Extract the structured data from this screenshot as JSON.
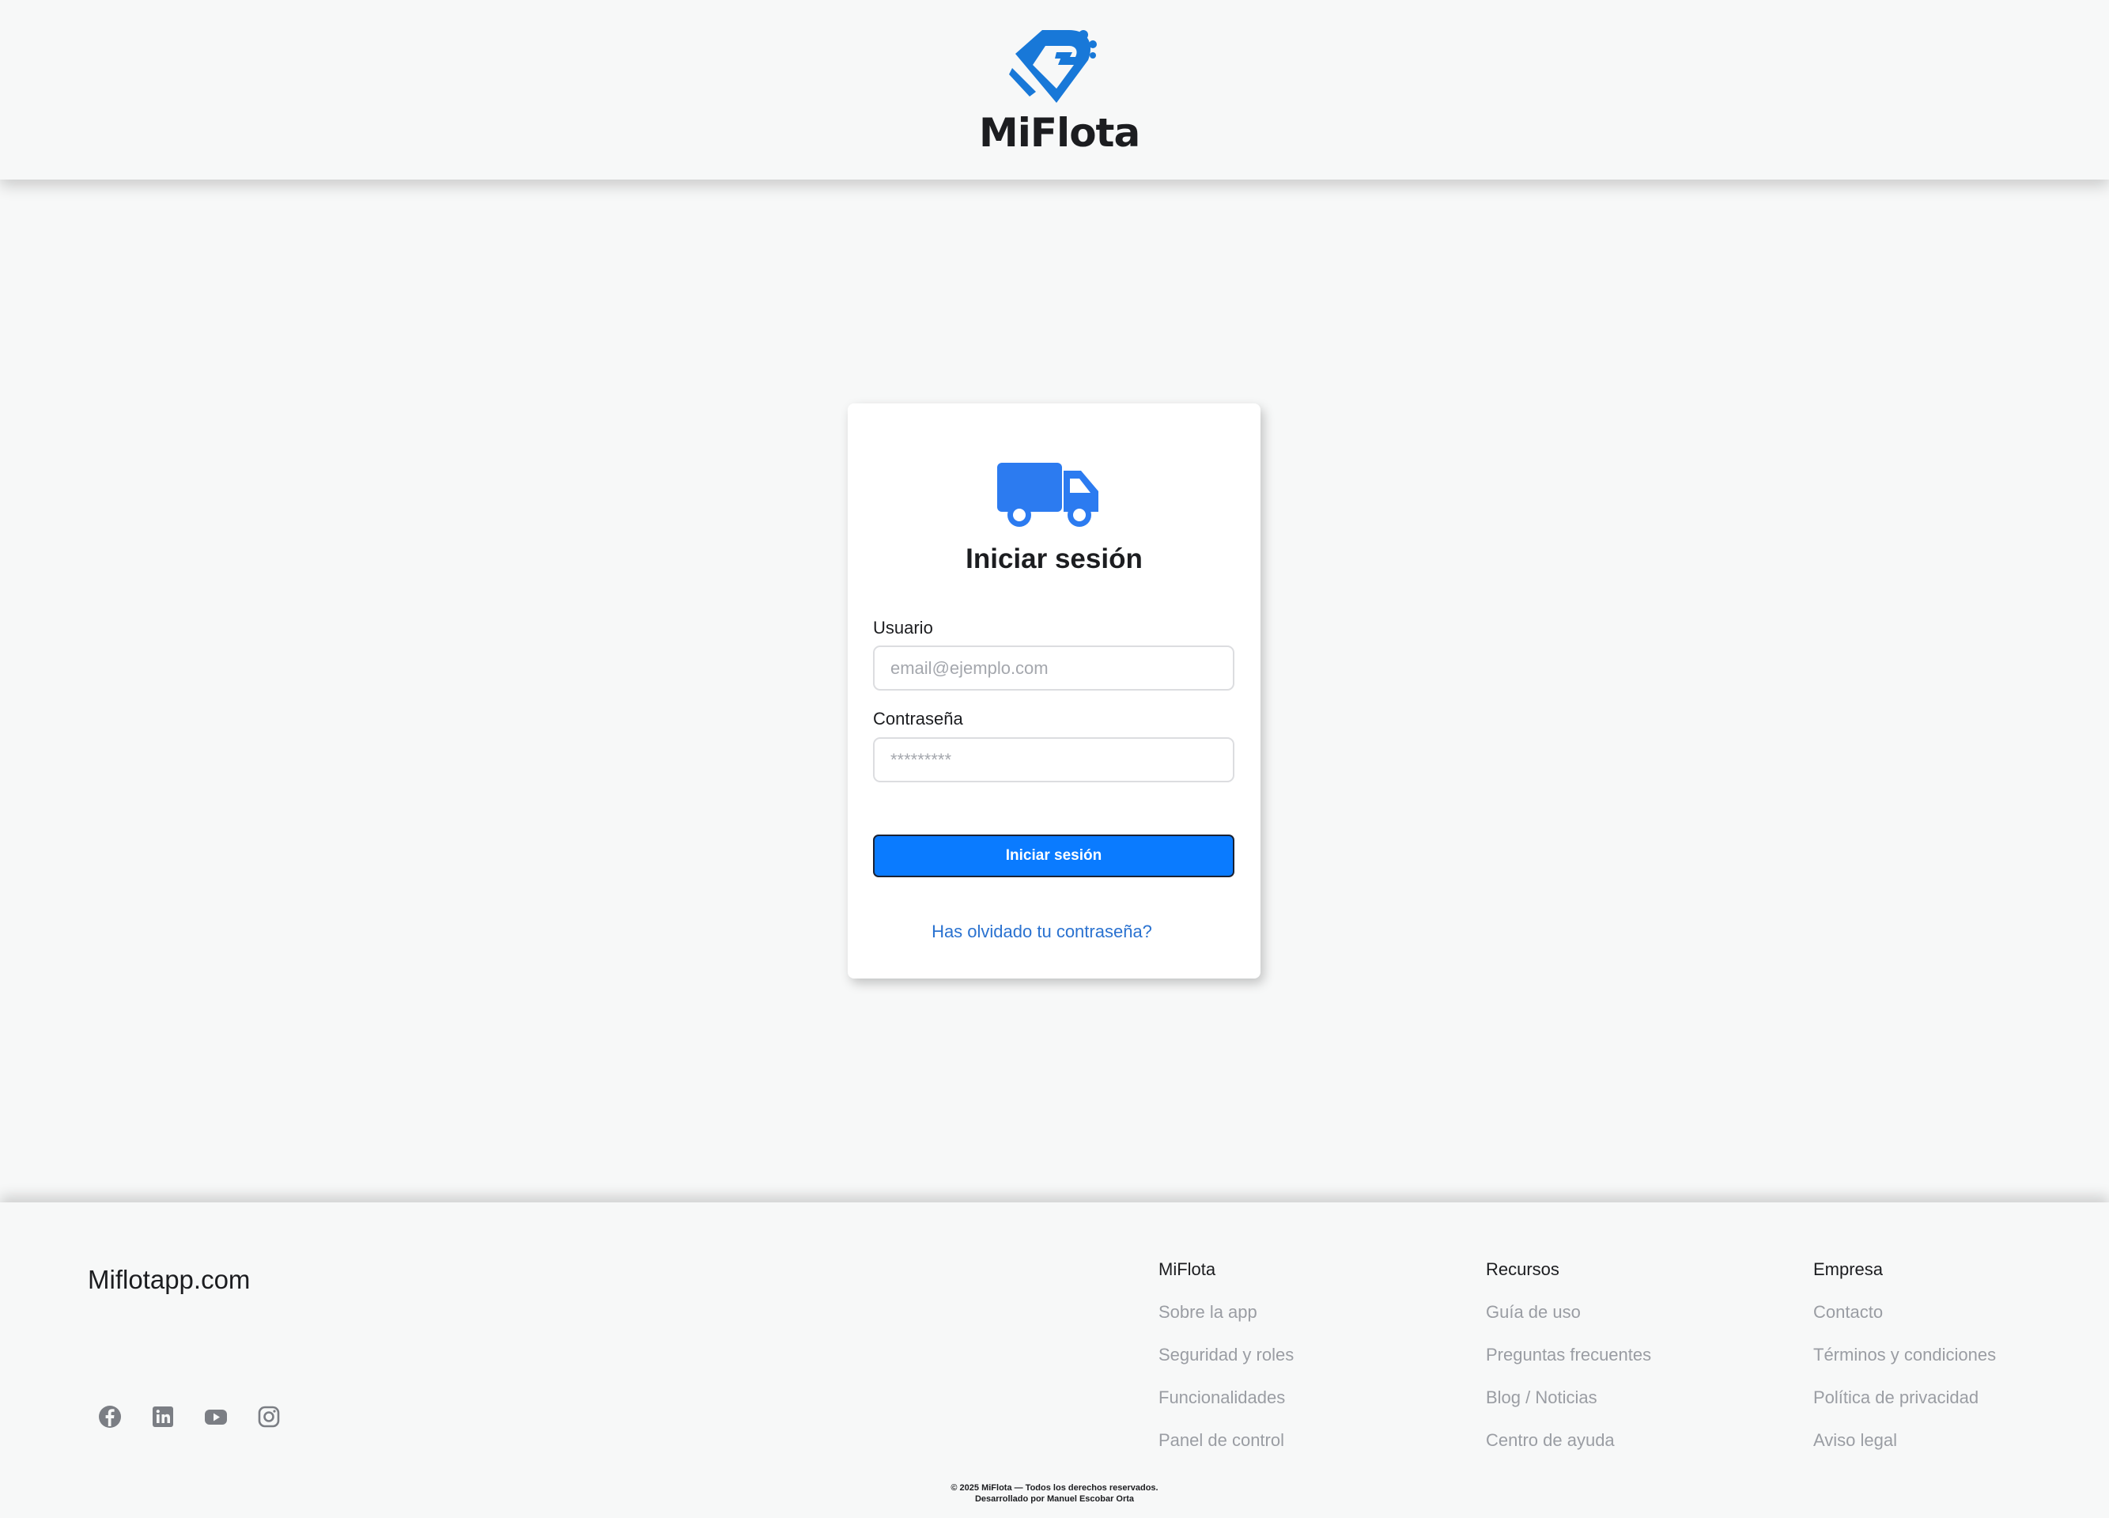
{
  "header": {
    "brand_name": "MiFlota",
    "brand_color": "#1878d8"
  },
  "login": {
    "title": "Iniciar sesión",
    "username_label": "Usuario",
    "username_placeholder": "email@ejemplo.com",
    "password_label": "Contraseña",
    "password_placeholder": "*********",
    "submit_label": "Iniciar sesión",
    "forgot_label": "Has olvidado tu contraseña?",
    "accent_color": "#0a7bff"
  },
  "footer": {
    "site_name": "Miflotapp.com",
    "social": [
      "facebook-icon",
      "linkedin-icon",
      "youtube-icon",
      "instagram-icon"
    ],
    "columns": [
      {
        "title": "MiFlota",
        "links": [
          "Sobre la app",
          "Seguridad y roles",
          "Funcionalidades",
          "Panel de control"
        ]
      },
      {
        "title": "Recursos",
        "links": [
          "Guía de uso",
          "Preguntas frecuentes",
          "Blog / Noticias",
          "Centro de ayuda"
        ]
      },
      {
        "title": "Empresa",
        "links": [
          "Contacto",
          "Términos y condiciones",
          "Política de privacidad",
          "Aviso legal"
        ]
      }
    ],
    "copyright_line1": "© 2025 MiFlota — Todos los derechos reservados.",
    "copyright_line2": "Desarrollado por Manuel Escobar Orta"
  }
}
